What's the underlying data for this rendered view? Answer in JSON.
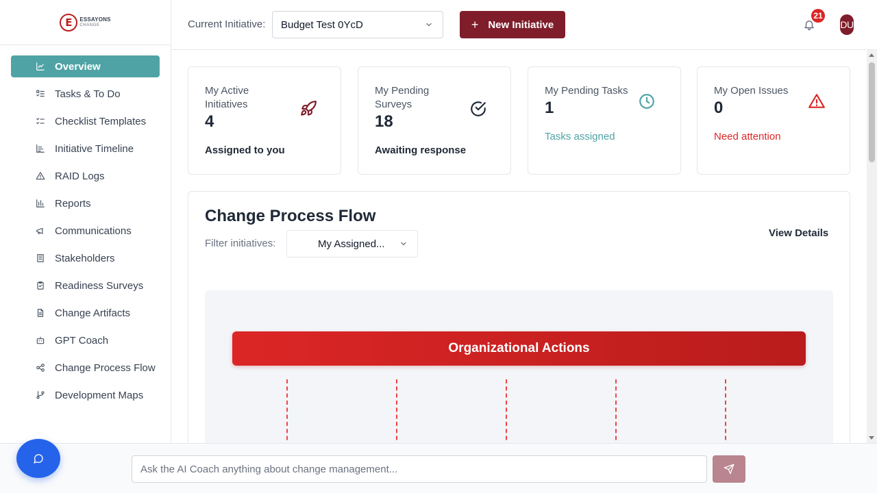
{
  "brand": {
    "logo_letter": "E",
    "logo_line1": "ESSAYONS",
    "logo_line2": "CHANGE"
  },
  "sidebar": {
    "items": [
      {
        "label": "Overview",
        "icon": "chart-line-icon",
        "active": true
      },
      {
        "label": "Tasks & To Do",
        "icon": "list-todo-icon"
      },
      {
        "label": "Checklist Templates",
        "icon": "list-checks-icon"
      },
      {
        "label": "Initiative Timeline",
        "icon": "timeline-icon"
      },
      {
        "label": "RAID Logs",
        "icon": "alert-triangle-icon"
      },
      {
        "label": "Reports",
        "icon": "bar-chart-icon"
      },
      {
        "label": "Communications",
        "icon": "megaphone-icon"
      },
      {
        "label": "Stakeholders",
        "icon": "building-icon"
      },
      {
        "label": "Readiness Surveys",
        "icon": "clipboard-check-icon"
      },
      {
        "label": "Change Artifacts",
        "icon": "file-text-icon"
      },
      {
        "label": "GPT Coach",
        "icon": "bot-icon"
      },
      {
        "label": "Change Process Flow",
        "icon": "workflow-icon"
      },
      {
        "label": "Development Maps",
        "icon": "git-branch-icon"
      }
    ]
  },
  "header": {
    "current_initiative_label": "Current Initiative:",
    "current_initiative_value": "Budget Test 0YcD",
    "new_initiative_label": "New Initiative",
    "notification_count": "21",
    "avatar_initials": "DU"
  },
  "cards": [
    {
      "title": "My Active Initiatives",
      "value": "4",
      "subtitle": "Assigned to you",
      "icon": "rocket-icon",
      "accent": "#7f1d2b"
    },
    {
      "title": "My Pending Surveys",
      "value": "18",
      "subtitle": "Awaiting response",
      "icon": "check-circle-icon",
      "accent": "#1f2937"
    },
    {
      "title": "My Pending Tasks",
      "value": "1",
      "subtitle": "Tasks assigned",
      "icon": "clock-icon",
      "accent": "#4fa3a5"
    },
    {
      "title": "My Open Issues",
      "value": "0",
      "subtitle": "Need attention",
      "icon": "alert-triangle-icon",
      "accent": "#dc2626"
    }
  ],
  "flow": {
    "title": "Change Process Flow",
    "filter_label": "Filter initiatives:",
    "filter_value": "My Assigned...",
    "view_details_label": "View Details",
    "org_actions_label": "Organizational Actions"
  },
  "chat": {
    "placeholder": "Ask the AI Coach anything about change management...",
    "value": ""
  },
  "colors": {
    "primary_teal": "#4fa3a5",
    "brand_maroon": "#7f1d2b",
    "danger_red": "#dc2626",
    "chat_blue": "#2563eb"
  }
}
